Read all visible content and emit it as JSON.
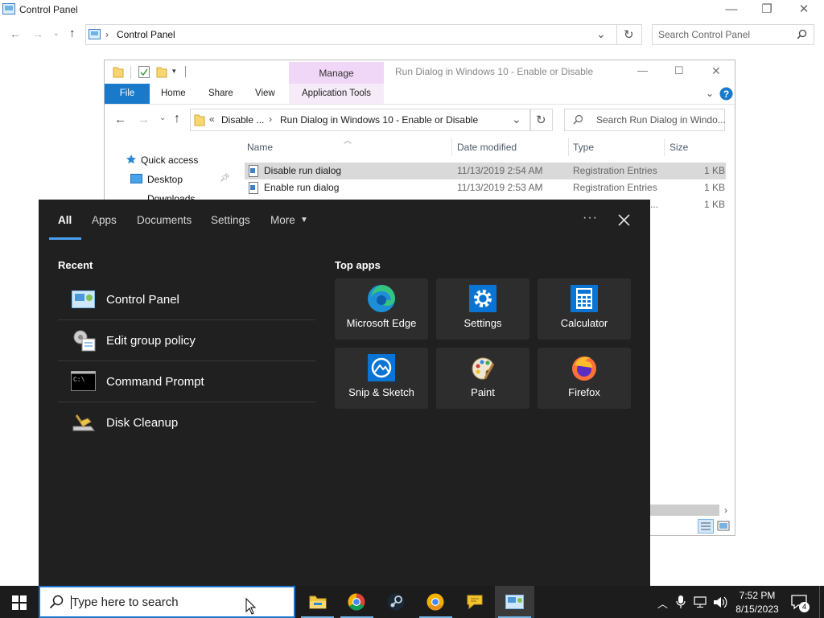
{
  "control_panel": {
    "title": "Control Panel",
    "address": "Control Panel",
    "search_placeholder": "Search Control Panel"
  },
  "explorer": {
    "manage_label": "Manage",
    "title": "Run Dialog in Windows 10 - Enable or Disable",
    "ribbon_tabs": [
      "File",
      "Home",
      "Share",
      "View",
      "Application Tools"
    ],
    "breadcrumb": [
      "Disable ...",
      "Run Dialog in Windows 10 - Enable or Disable"
    ],
    "search_placeholder": "Search Run Dialog in Windo...",
    "columns": {
      "name": "Name",
      "date": "Date modified",
      "type": "Type",
      "size": "Size"
    },
    "files": [
      {
        "name": "Disable run dialog",
        "date": "11/13/2019 2:54 AM",
        "type": "Registration Entries",
        "size": "1 KB",
        "selected": true
      },
      {
        "name": "Enable run dialog",
        "date": "11/13/2019 2:53 AM",
        "type": "Registration Entries",
        "size": "1 KB",
        "selected": false
      }
    ],
    "partial_row": {
      "type_tail": "...",
      "size": "1 KB"
    },
    "nav": [
      "Quick access",
      "Desktop",
      "Downloads"
    ]
  },
  "search_panel": {
    "tabs": [
      "All",
      "Apps",
      "Documents",
      "Settings",
      "More"
    ],
    "active_tab": "All",
    "recent_heading": "Recent",
    "recent": [
      "Control Panel",
      "Edit group policy",
      "Command Prompt",
      "Disk Cleanup"
    ],
    "top_apps_heading": "Top apps",
    "top_apps": [
      "Microsoft Edge",
      "Settings",
      "Calculator",
      "Snip & Sketch",
      "Paint",
      "Firefox"
    ]
  },
  "taskbar": {
    "search_placeholder": "Type here to search",
    "pinned": [
      "file-explorer",
      "chrome",
      "steam",
      "chrome-canary",
      "feedback",
      "control-panel"
    ],
    "time": "7:52 PM",
    "date": "8/15/2023",
    "notification_count": "4"
  },
  "colors": {
    "accent": "#1979ca",
    "panel_bg": "#202020",
    "taskbar_bg": "#1c1c1c",
    "manage_tab": "#f0d7f7"
  }
}
